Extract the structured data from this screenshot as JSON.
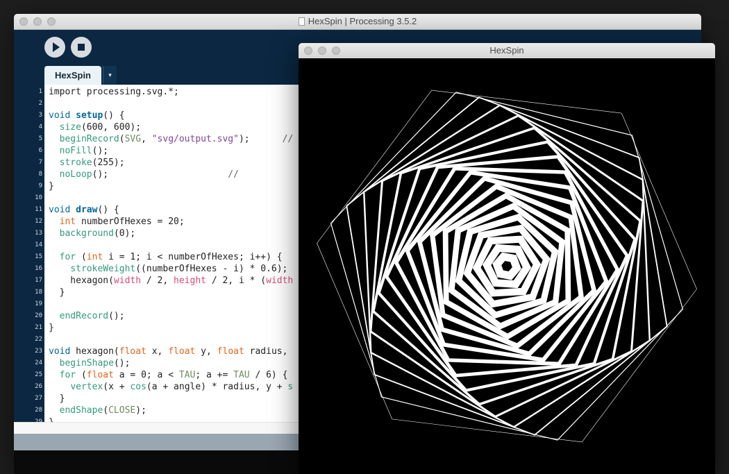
{
  "ide": {
    "title": "HexSpin | Processing 3.5.2",
    "tab_label": "HexSpin",
    "tab_menu_glyph": "▾",
    "icons": [
      "play-icon",
      "stop-icon",
      "document-icon",
      "dropdown-icon"
    ]
  },
  "sketch": {
    "title": "HexSpin",
    "hexagons": {
      "count": 20,
      "center": [
        0.5,
        0.5
      ],
      "stroke_color": "#ffffff",
      "background_color": "#000000"
    }
  },
  "code": [
    {
      "n": "1",
      "tokens": [
        {
          "t": "import processing.svg.*;",
          "c": "plain"
        }
      ]
    },
    {
      "n": "2",
      "tokens": []
    },
    {
      "n": "3",
      "tokens": [
        {
          "t": "void",
          "c": "blue"
        },
        {
          "t": " ",
          "c": "plain"
        },
        {
          "t": "setup",
          "c": "fn"
        },
        {
          "t": "() {",
          "c": "plain"
        }
      ]
    },
    {
      "n": "4",
      "tokens": [
        {
          "t": "  ",
          "c": "plain"
        },
        {
          "t": "size",
          "c": "kw"
        },
        {
          "t": "(600, 600);",
          "c": "plain"
        }
      ]
    },
    {
      "n": "5",
      "tokens": [
        {
          "t": "  ",
          "c": "plain"
        },
        {
          "t": "beginRecord",
          "c": "kw"
        },
        {
          "t": "(",
          "c": "plain"
        },
        {
          "t": "SVG",
          "c": "const"
        },
        {
          "t": ", ",
          "c": "plain"
        },
        {
          "t": "\"svg/output.svg\"",
          "c": "str"
        },
        {
          "t": ");      ",
          "c": "plain"
        },
        {
          "t": "//",
          "c": "com"
        }
      ]
    },
    {
      "n": "6",
      "tokens": [
        {
          "t": "  ",
          "c": "plain"
        },
        {
          "t": "noFill",
          "c": "kw"
        },
        {
          "t": "();",
          "c": "plain"
        }
      ]
    },
    {
      "n": "7",
      "tokens": [
        {
          "t": "  ",
          "c": "plain"
        },
        {
          "t": "stroke",
          "c": "kw"
        },
        {
          "t": "(255);",
          "c": "plain"
        }
      ]
    },
    {
      "n": "8",
      "tokens": [
        {
          "t": "  ",
          "c": "plain"
        },
        {
          "t": "noLoop",
          "c": "kw"
        },
        {
          "t": "();                      ",
          "c": "plain"
        },
        {
          "t": "//",
          "c": "com"
        }
      ]
    },
    {
      "n": "9",
      "tokens": [
        {
          "t": "}",
          "c": "plain"
        }
      ]
    },
    {
      "n": "10",
      "tokens": []
    },
    {
      "n": "11",
      "tokens": [
        {
          "t": "void",
          "c": "blue"
        },
        {
          "t": " ",
          "c": "plain"
        },
        {
          "t": "draw",
          "c": "fn"
        },
        {
          "t": "() {",
          "c": "plain"
        }
      ]
    },
    {
      "n": "12",
      "tokens": [
        {
          "t": "  ",
          "c": "plain"
        },
        {
          "t": "int",
          "c": "type"
        },
        {
          "t": " numberOfHexes = 20;",
          "c": "plain"
        }
      ]
    },
    {
      "n": "13",
      "tokens": [
        {
          "t": "  ",
          "c": "plain"
        },
        {
          "t": "background",
          "c": "kw"
        },
        {
          "t": "(0);",
          "c": "plain"
        }
      ]
    },
    {
      "n": "14",
      "tokens": []
    },
    {
      "n": "15",
      "tokens": [
        {
          "t": "  ",
          "c": "plain"
        },
        {
          "t": "for",
          "c": "kw"
        },
        {
          "t": " (",
          "c": "plain"
        },
        {
          "t": "int",
          "c": "type"
        },
        {
          "t": " i = 1; i < numberOfHexes; i++) {",
          "c": "plain"
        }
      ]
    },
    {
      "n": "16",
      "tokens": [
        {
          "t": "    ",
          "c": "plain"
        },
        {
          "t": "strokeWeight",
          "c": "kw"
        },
        {
          "t": "((numberOfHexes - i) * 0.6);",
          "c": "plain"
        }
      ]
    },
    {
      "n": "17",
      "tokens": [
        {
          "t": "    hexagon(",
          "c": "plain"
        },
        {
          "t": "width",
          "c": "pink"
        },
        {
          "t": " / 2, ",
          "c": "plain"
        },
        {
          "t": "height",
          "c": "pink"
        },
        {
          "t": " / 2, i * (",
          "c": "plain"
        },
        {
          "t": "width",
          "c": "pink"
        }
      ]
    },
    {
      "n": "18",
      "tokens": [
        {
          "t": "  }",
          "c": "plain"
        }
      ]
    },
    {
      "n": "19",
      "tokens": []
    },
    {
      "n": "20",
      "tokens": [
        {
          "t": "  ",
          "c": "plain"
        },
        {
          "t": "endRecord",
          "c": "kw"
        },
        {
          "t": "();",
          "c": "plain"
        }
      ]
    },
    {
      "n": "21",
      "tokens": [
        {
          "t": "}",
          "c": "plain"
        }
      ]
    },
    {
      "n": "22",
      "tokens": []
    },
    {
      "n": "23",
      "tokens": [
        {
          "t": "void",
          "c": "blue"
        },
        {
          "t": " hexagon(",
          "c": "plain"
        },
        {
          "t": "float",
          "c": "type"
        },
        {
          "t": " x, ",
          "c": "plain"
        },
        {
          "t": "float",
          "c": "type"
        },
        {
          "t": " y, ",
          "c": "plain"
        },
        {
          "t": "float",
          "c": "type"
        },
        {
          "t": " radius,",
          "c": "plain"
        }
      ]
    },
    {
      "n": "24",
      "tokens": [
        {
          "t": "  ",
          "c": "plain"
        },
        {
          "t": "beginShape",
          "c": "kw"
        },
        {
          "t": "();",
          "c": "plain"
        }
      ]
    },
    {
      "n": "25",
      "tokens": [
        {
          "t": "  ",
          "c": "plain"
        },
        {
          "t": "for",
          "c": "kw"
        },
        {
          "t": " (",
          "c": "plain"
        },
        {
          "t": "float",
          "c": "type"
        },
        {
          "t": " a = 0; a < ",
          "c": "plain"
        },
        {
          "t": "TAU",
          "c": "const"
        },
        {
          "t": "; a += ",
          "c": "plain"
        },
        {
          "t": "TAU",
          "c": "const"
        },
        {
          "t": " / 6) {",
          "c": "plain"
        }
      ]
    },
    {
      "n": "26",
      "tokens": [
        {
          "t": "    ",
          "c": "plain"
        },
        {
          "t": "vertex",
          "c": "kw"
        },
        {
          "t": "(x + ",
          "c": "plain"
        },
        {
          "t": "cos",
          "c": "kw"
        },
        {
          "t": "(a + angle) * radius, y + ",
          "c": "plain"
        },
        {
          "t": "s",
          "c": "kw"
        }
      ]
    },
    {
      "n": "27",
      "tokens": [
        {
          "t": "  }",
          "c": "plain"
        }
      ]
    },
    {
      "n": "28",
      "tokens": [
        {
          "t": "  ",
          "c": "plain"
        },
        {
          "t": "endShape",
          "c": "kw"
        },
        {
          "t": "(",
          "c": "plain"
        },
        {
          "t": "CLOSE",
          "c": "const"
        },
        {
          "t": ");",
          "c": "plain"
        }
      ]
    },
    {
      "n": "29",
      "tokens": [
        {
          "t": "}",
          "c": "plain"
        }
      ]
    }
  ]
}
